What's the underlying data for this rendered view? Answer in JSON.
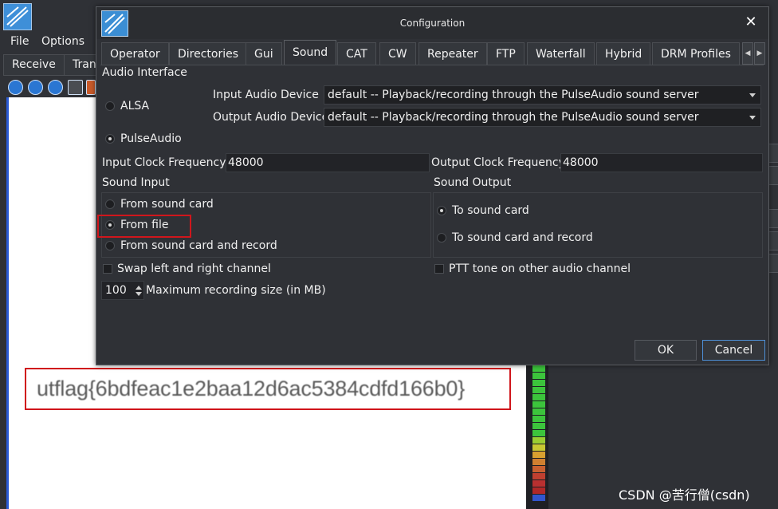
{
  "background_app": {
    "menu": [
      "File",
      "Options"
    ],
    "tabs": [
      "Receive",
      "Tran"
    ],
    "flag_text": "utflag{6bdfeac1e2baa12d6ac5384cdfd166b0}",
    "watermark": "CSDN @苦行僧(csdn)"
  },
  "dialog": {
    "title": "Configuration",
    "close_glyph": "✕",
    "tabs": [
      "Operator",
      "Directories",
      "Gui",
      "Sound",
      "CAT",
      "CW",
      "Repeater",
      "FTP",
      "Waterfall",
      "Hybrid",
      "DRM Profiles"
    ],
    "active_tab": "Sound",
    "audio_interface": {
      "heading": "Audio Interface",
      "options": [
        "ALSA",
        "PulseAudio"
      ],
      "selected": "PulseAudio",
      "input_device_label": "Input Audio Device",
      "input_device_value": "default -- Playback/recording through the PulseAudio sound server",
      "output_device_label": "Output Audio Device",
      "output_device_value": "default -- Playback/recording through the PulseAudio sound server"
    },
    "clock": {
      "input_label": "Input  Clock Frequency",
      "input_value": "48000",
      "output_label": "Output Clock Frequency",
      "output_value": "48000"
    },
    "sound_input": {
      "heading": "Sound Input",
      "options": [
        "From sound card",
        "From file",
        "From sound card and record"
      ],
      "selected": "From file"
    },
    "sound_output": {
      "heading": "Sound Output",
      "options": [
        "To sound card",
        "To sound card and record"
      ],
      "selected": "To sound card"
    },
    "swap_channels_label": "Swap left and right channel",
    "ptt_tone_label": "PTT tone on other audio channel",
    "max_recording": {
      "value": "100",
      "label": "Maximum recording size (in MB)"
    },
    "ok_label": "OK",
    "cancel_label": "Cancel"
  },
  "colors": {
    "highlight_red": "#d0161c",
    "dialog_bg": "#2f3136",
    "accent_blue": "#4d8fd6"
  }
}
